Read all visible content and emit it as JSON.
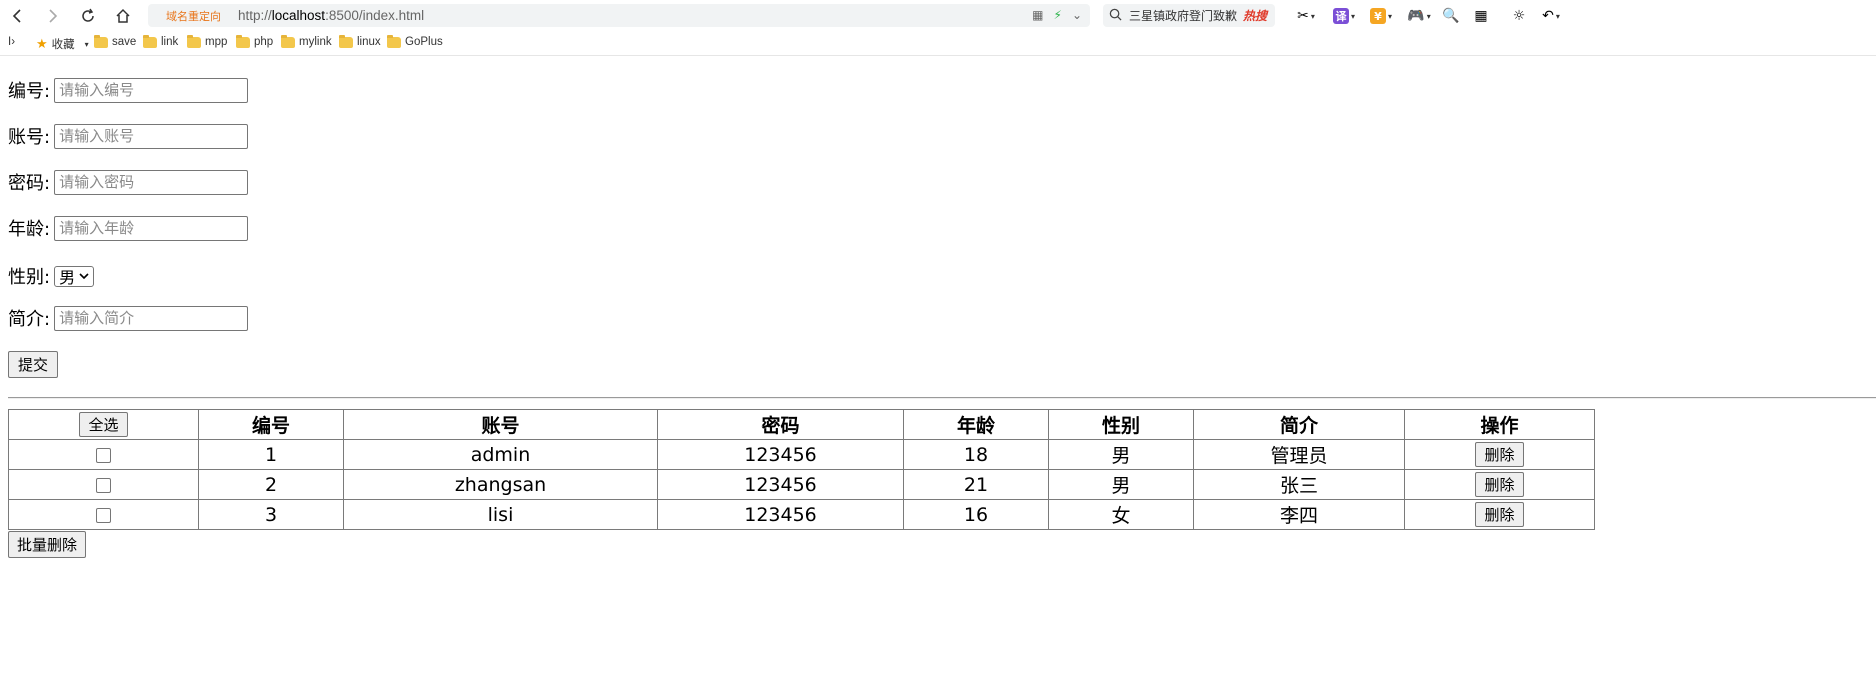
{
  "browser": {
    "redirect_tag": "域名重定向",
    "url_prefix": "http://",
    "url_host": "localhost",
    "url_rest": ":8500/index.html",
    "search_text": "三星镇政府登门致歉",
    "search_hot": "热搜",
    "ext_translate": "译",
    "ext_money": "¥",
    "bookmarks": [
      "收藏",
      "save",
      "link",
      "mpp",
      "php",
      "mylink",
      "linux",
      "GoPlus"
    ]
  },
  "form": {
    "id_label": "编号:",
    "id_placeholder": "请输入编号",
    "account_label": "账号:",
    "account_placeholder": "请输入账号",
    "password_label": "密码:",
    "password_placeholder": "请输入密码",
    "age_label": "年龄:",
    "age_placeholder": "请输入年龄",
    "gender_label": "性别:",
    "gender_value": "男",
    "intro_label": "简介:",
    "intro_placeholder": "请输入简介",
    "submit_label": "提交"
  },
  "table": {
    "select_all_label": "全选",
    "headers": [
      "编号",
      "账号",
      "密码",
      "年龄",
      "性别",
      "简介",
      "操作"
    ],
    "rows": [
      {
        "id": "1",
        "account": "admin",
        "password": "123456",
        "age": "18",
        "gender": "男",
        "intro": "管理员",
        "action": "删除"
      },
      {
        "id": "2",
        "account": "zhangsan",
        "password": "123456",
        "age": "21",
        "gender": "男",
        "intro": "张三",
        "action": "删除"
      },
      {
        "id": "3",
        "account": "lisi",
        "password": "123456",
        "age": "16",
        "gender": "女",
        "intro": "李四",
        "action": "删除"
      }
    ],
    "batch_delete_label": "批量删除"
  }
}
